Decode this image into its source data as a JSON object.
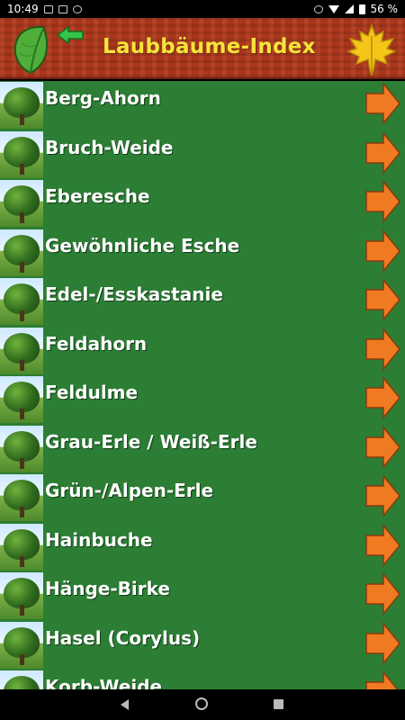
{
  "status_bar": {
    "time": "10:49",
    "battery": "56 %"
  },
  "header": {
    "title": "Laubbäume-Index",
    "leaf_icon": "leaf-icon",
    "back_icon": "arrow-left-icon",
    "logo_icon": "maple-leaf-icon"
  },
  "list": {
    "items": [
      {
        "label": "Berg-Ahorn"
      },
      {
        "label": "Bruch-Weide"
      },
      {
        "label": "Eberesche"
      },
      {
        "label": "Gewöhnliche Esche"
      },
      {
        "label": "Edel-/Esskastanie"
      },
      {
        "label": "Feldahorn"
      },
      {
        "label": "Feldulme"
      },
      {
        "label": "Grau-Erle / Weiß-Erle"
      },
      {
        "label": "Grün-/Alpen-Erle"
      },
      {
        "label": "Hainbuche"
      },
      {
        "label": "Hänge-Birke"
      },
      {
        "label": "Hasel (Corylus)"
      },
      {
        "label": "Korb-Weide"
      }
    ]
  },
  "colors": {
    "header_bg": "#a8351c",
    "title": "#f5e43a",
    "list_bg": "#2b7e34",
    "arrow": "#f07a22"
  }
}
